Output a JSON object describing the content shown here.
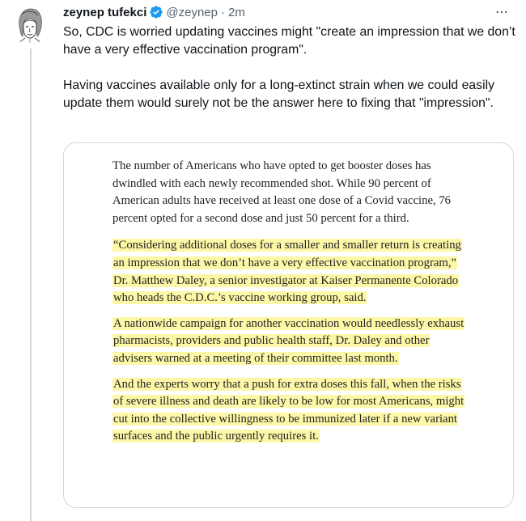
{
  "author": {
    "name": "zeynep tufekci",
    "handle": "@zeynep",
    "separator": "·",
    "time": "2m",
    "verified_icon": "verified-badge-icon",
    "avatar_icon": "avatar-sketch"
  },
  "more_icon": "more-icon",
  "tweet": {
    "paragraph1": "So, CDC is worried updating vaccines might \"create an impression that we don’t have a very effective vaccination program\".",
    "paragraph2": "Having vaccines available only for a long-extinct strain when we could easily update them would surely not be the answer here to fixing that \"impression\"."
  },
  "article": {
    "intro": "The number of Americans who have opted to get booster doses has dwindled with each newly recommended shot. While 90 percent of American adults have received at least one dose of a Covid vaccine, 76 percent opted for a second dose and just 50 percent for a third.",
    "quote": "“Considering additional doses for a smaller and smaller return is creating an impression that we don’t have a very effective vaccination program,” Dr. Matthew Daley, a senior investigator at Kaiser Permanente Colorado who heads the C.D.C.’s vaccine working group, said.",
    "campaign": "A nationwide campaign for another vaccination would needlessly exhaust pharmacists, providers and public health staff, Dr. Daley and other advisers warned at a meeting of their committee last month.",
    "worry": "And the experts worry that a push for extra doses this fall, when the risks of severe illness and death are likely to be low for most Americans, might cut into the collective willingness to be immunized later if a new variant surfaces and the public urgently requires it."
  },
  "colors": {
    "text": "#0f1419",
    "secondary": "#536471",
    "verified": "#1d9bf0",
    "highlight": "#fdf8a8",
    "border": "#cfd9de"
  }
}
